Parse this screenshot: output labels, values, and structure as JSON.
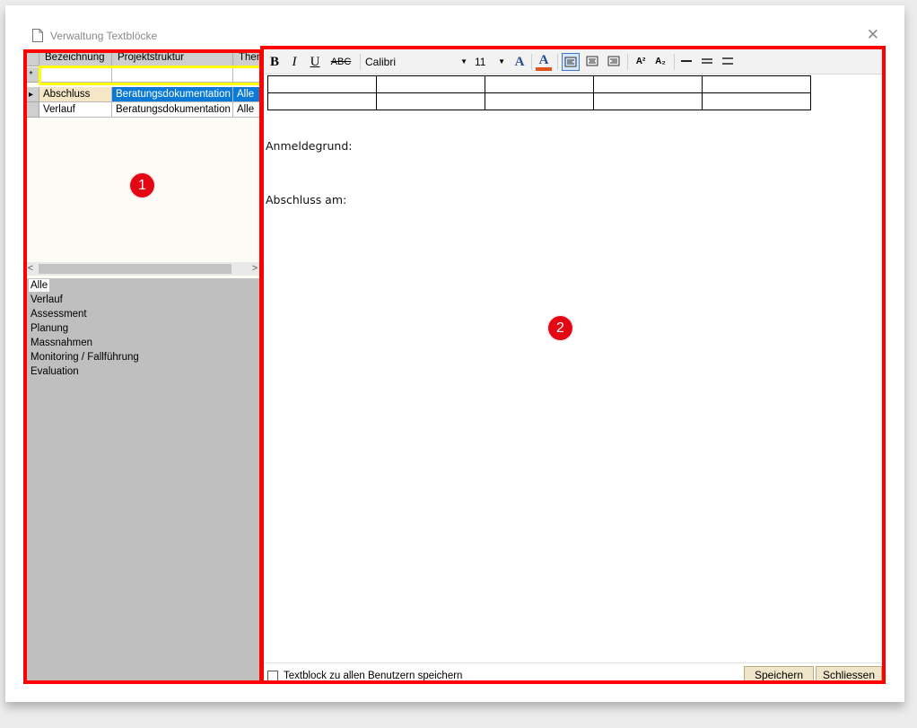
{
  "window": {
    "title": "Verwaltung Textblöcke",
    "close_glyph": "✕",
    "doc_icon": "document-icon"
  },
  "grid": {
    "columns": [
      "Bezeichnung",
      "Projektstruktur",
      "Thema"
    ],
    "new_row_marker": "*",
    "current_row_marker": "▸",
    "rows": [
      {
        "bezeichnung": "Abschluss",
        "projektstruktur": "Beratungsdokumentation",
        "thema": "Alle"
      },
      {
        "bezeichnung": "Verlauf",
        "projektstruktur": "Beratungsdokumentation",
        "thema": "Alle"
      }
    ],
    "scroll_left": "<",
    "scroll_right": ">"
  },
  "themes": [
    "Alle",
    "Verlauf",
    "Assessment",
    "Planung",
    "Massnahmen",
    "Monitoring / Fallführung",
    "Evaluation"
  ],
  "toolbar": {
    "bold": "B",
    "italic": "I",
    "underline": "U",
    "strike": "ABC",
    "font": "Calibri",
    "size": "11",
    "font_color": "A",
    "highlight_color": "A",
    "superscript": "A²",
    "subscript": "A₂"
  },
  "editor": {
    "lines": [
      "Anmeldegrund:",
      "Abschluss am:"
    ]
  },
  "footer": {
    "checkbox_label": "Textblock zu allen Benutzern speichern",
    "save": "Speichern",
    "close": "Schliessen"
  },
  "annotations": {
    "left": "1",
    "right": "2",
    "color": "#ff0000",
    "highlight": "#ffff00"
  }
}
